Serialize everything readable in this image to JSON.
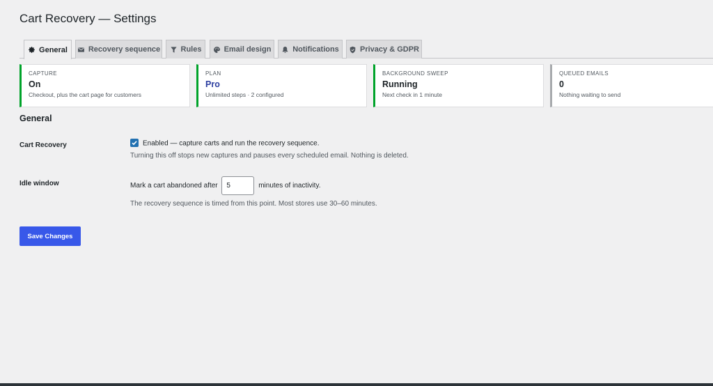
{
  "page_title": "Cart Recovery — Settings",
  "tabs": [
    {
      "label": "General",
      "icon": "gear-icon",
      "active": true
    },
    {
      "label": "Recovery sequence",
      "icon": "envelope-icon",
      "active": false
    },
    {
      "label": "Rules",
      "icon": "filter-icon",
      "active": false
    },
    {
      "label": "Email design",
      "icon": "palette-icon",
      "active": false
    },
    {
      "label": "Notifications",
      "icon": "bell-icon",
      "active": false
    },
    {
      "label": "Privacy & GDPR",
      "icon": "shield-icon",
      "active": false
    }
  ],
  "cards": [
    {
      "label": "CAPTURE",
      "value": "On",
      "sub": "Checkout, plus the cart page for customers"
    },
    {
      "label": "PLAN",
      "value": "Pro",
      "sub": "Unlimited steps · 2 configured"
    },
    {
      "label": "BACKGROUND SWEEP",
      "value": "Running",
      "sub": "Next check in 1 minute"
    },
    {
      "label": "QUEUED EMAILS",
      "value": "0",
      "sub": "Nothing waiting to send"
    }
  ],
  "section_title": "General",
  "cart_recovery": {
    "label": "Cart Recovery",
    "checked": true,
    "checkbox_label": "Enabled — capture carts and run the recovery sequence.",
    "description": "Turning this off stops new captures and pauses every scheduled email. Nothing is deleted."
  },
  "idle_window": {
    "label": "Idle window",
    "prefix": "Mark a cart abandoned after",
    "value": "5",
    "suffix": "minutes of inactivity.",
    "description": "The recovery sequence is timed from this point. Most stores use 30–60 minutes."
  },
  "save_label": "Save Changes",
  "colors": {
    "accent": "#3858e9",
    "checkbox": "#2271b1",
    "status_green": "#00a32a",
    "status_gray": "#a7aaad",
    "plan_link": "#2c3ea0"
  }
}
